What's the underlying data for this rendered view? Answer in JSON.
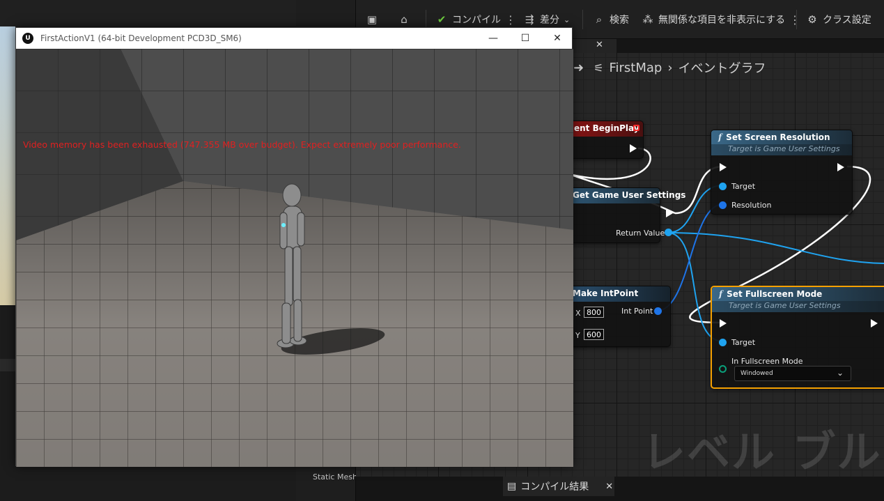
{
  "toolbar": {
    "compile_label": "コンパイル",
    "diff_label": "差分",
    "search_label": "検索",
    "hide_unrelated_label": "無関係な項目を非表示にする",
    "class_settings_label": "クラス設定"
  },
  "graph": {
    "breadcrumb_map": "FirstMap",
    "breadcrumb_graph": "イベントグラフ",
    "watermark": "レベル ブルー"
  },
  "nodes": {
    "begin_play": {
      "title": "ent BeginPlay"
    },
    "get_user_settings": {
      "title": "Get Game User Settings",
      "return_value": "Return Value"
    },
    "set_screen_resolution": {
      "title": "Set Screen Resolution",
      "subtitle": "Target is Game User Settings",
      "target": "Target",
      "resolution": "Resolution"
    },
    "make_intpoint": {
      "title": "Make IntPoint",
      "x_label": "X",
      "x_value": "800",
      "y_label": "Y",
      "y_value": "600",
      "output": "Int Point"
    },
    "set_fullscreen_mode": {
      "title": "Set Fullscreen Mode",
      "subtitle": "Target is Game User Settings",
      "target": "Target",
      "mode_label": "In Fullscreen Mode",
      "mode_value": "Windowed"
    }
  },
  "compile_results_tab": {
    "label": "コンパイル結果"
  },
  "left_panel": {
    "static_mesh_label": "Static Mesh"
  },
  "game_window": {
    "title": "FirstActionV1 (64-bit Development PCD3D_SM6)",
    "logo": "U",
    "warning": "Video memory has been exhausted (747.355 MB over budget). Expect extremely poor performance."
  },
  "colors": {
    "event_node_header": "#7a1111",
    "function_node_header": "#2f5876",
    "pure_node_header": "#2a5070",
    "selection_outline": "#f5a000",
    "object_pin": "#1fa3f0",
    "struct_pin": "#1e74e8",
    "warning_text": "#e02020"
  }
}
